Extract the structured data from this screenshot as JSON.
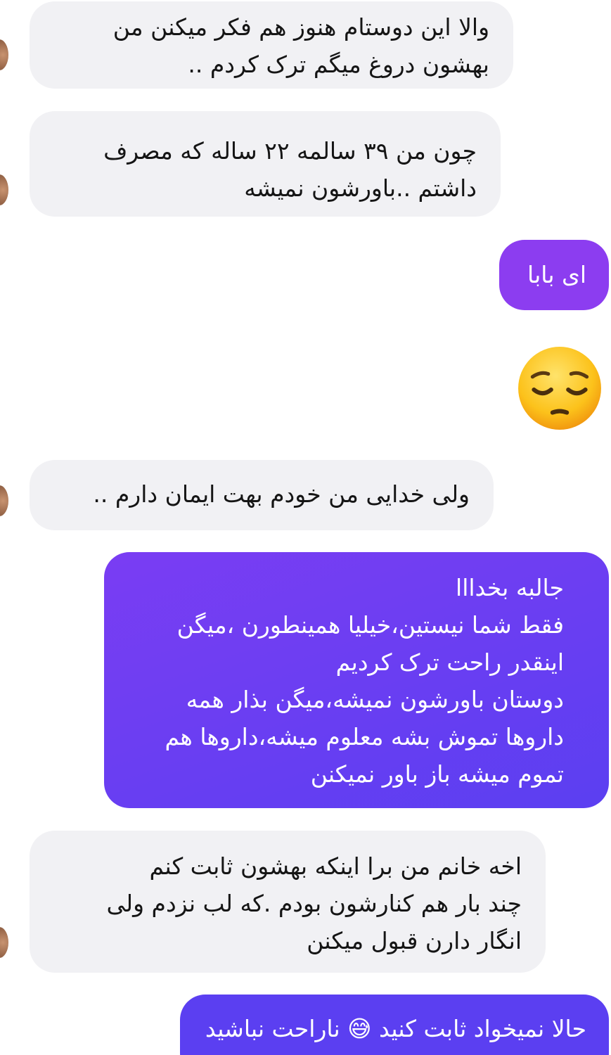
{
  "messages": [
    {
      "direction": "incoming",
      "text": "والا این  دوستام هنوز هم فکر میکنن من\nبهشون دروغ میگم ترک کردم .."
    },
    {
      "direction": "incoming",
      "text": "چون من ۳۹ سالمه ۲۲ ساله که مصرف\nداشتم ..باورشون نمیشه"
    },
    {
      "direction": "outgoing",
      "text": "ای بابا"
    },
    {
      "direction": "outgoing",
      "emoji": "pensive-face"
    },
    {
      "direction": "incoming",
      "text": "ولی خدایی من خودم بهت ایمان دارم .."
    },
    {
      "direction": "outgoing",
      "text": "جالبه بخدااا\nفقط شما نیستین،خیلیا همینطورن ،میگن\nاینقدر راحت ترک کردیم\nدوستان باورشون نمیشه،میگن  بذار همه\nداروها تموش بشه معلوم میشه،داروها هم\nتموم میشه باز باور نمیکنن"
    },
    {
      "direction": "incoming",
      "text": "اخه خانم من برا  اینکه بهشون ثابت کنم\nچند بار هم کنارشون بودم .که لب نزدم ولی\nانگار دارن قبول میکنن"
    },
    {
      "direction": "outgoing",
      "text": "حالا نمیخواد ثابت کنید 😅 ناراحت نباشید"
    }
  ],
  "colors": {
    "incoming_bg": "#f1f1f4",
    "outgoing_purple": "#8c3df0",
    "outgoing_indigo": "#5b3ff1"
  }
}
